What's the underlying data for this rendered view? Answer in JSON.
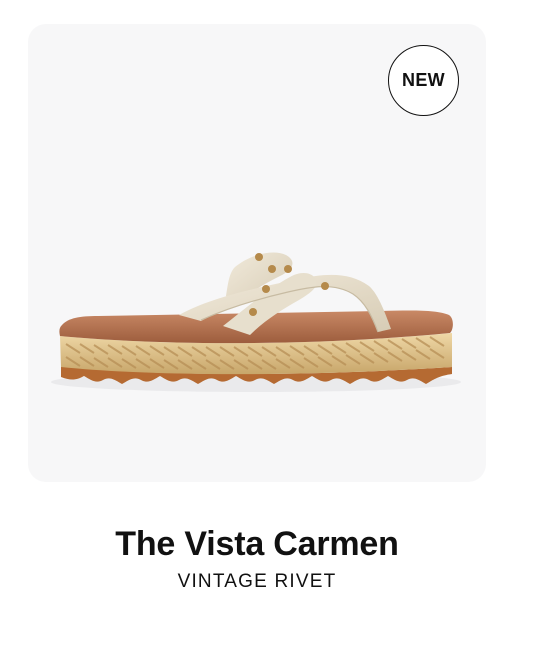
{
  "product": {
    "badge": "NEW",
    "title": "The Vista Carmen",
    "variant": "VINTAGE RIVET",
    "image": "sandal-photo"
  },
  "colors": {
    "card_background": "#f7f7f8",
    "text": "#111111",
    "strap": "#e8e0ce",
    "footbed": "#b57650",
    "jute": "#d8bf86",
    "outsole": "#b56a32",
    "rivet": "#b58a4b"
  }
}
